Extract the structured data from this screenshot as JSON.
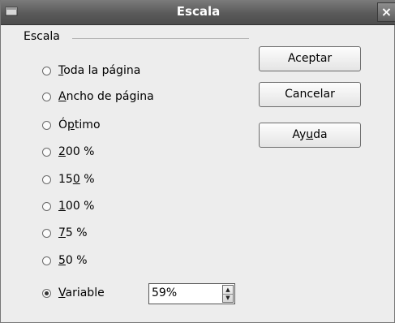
{
  "window": {
    "title": "Escala",
    "close_glyph": "×"
  },
  "frame": {
    "label": "Escala"
  },
  "options": [
    {
      "pre": "",
      "key": "T",
      "post": "oda la página",
      "checked": false
    },
    {
      "pre": "",
      "key": "A",
      "post": "ncho de página",
      "checked": false
    },
    {
      "pre": "Ó",
      "key": "p",
      "post": "timo",
      "checked": false
    },
    {
      "pre": "",
      "key": "2",
      "post": "00 %",
      "checked": false
    },
    {
      "pre": "15",
      "key": "0",
      "post": " %",
      "checked": false
    },
    {
      "pre": "",
      "key": "1",
      "post": "00 %",
      "checked": false
    },
    {
      "pre": "",
      "key": "7",
      "post": "5 %",
      "checked": false
    },
    {
      "pre": "",
      "key": "5",
      "post": "0 %",
      "checked": false
    },
    {
      "pre": "",
      "key": "V",
      "post": "ariable",
      "checked": true
    }
  ],
  "variable_field": {
    "value": "59%"
  },
  "buttons": {
    "accept_label": "Aceptar",
    "cancel_label": "Cancelar",
    "help_pre": "Ay",
    "help_key": "u",
    "help_post": "da"
  },
  "icons": {
    "title": "window-menu-icon",
    "close": "close-icon",
    "spin_up": "arrow-up-icon",
    "spin_down": "arrow-down-icon"
  },
  "colors": {
    "titlebar": "#5a5a5a",
    "dialog_bg": "#ededed",
    "button_border": "#6d6d6d"
  }
}
